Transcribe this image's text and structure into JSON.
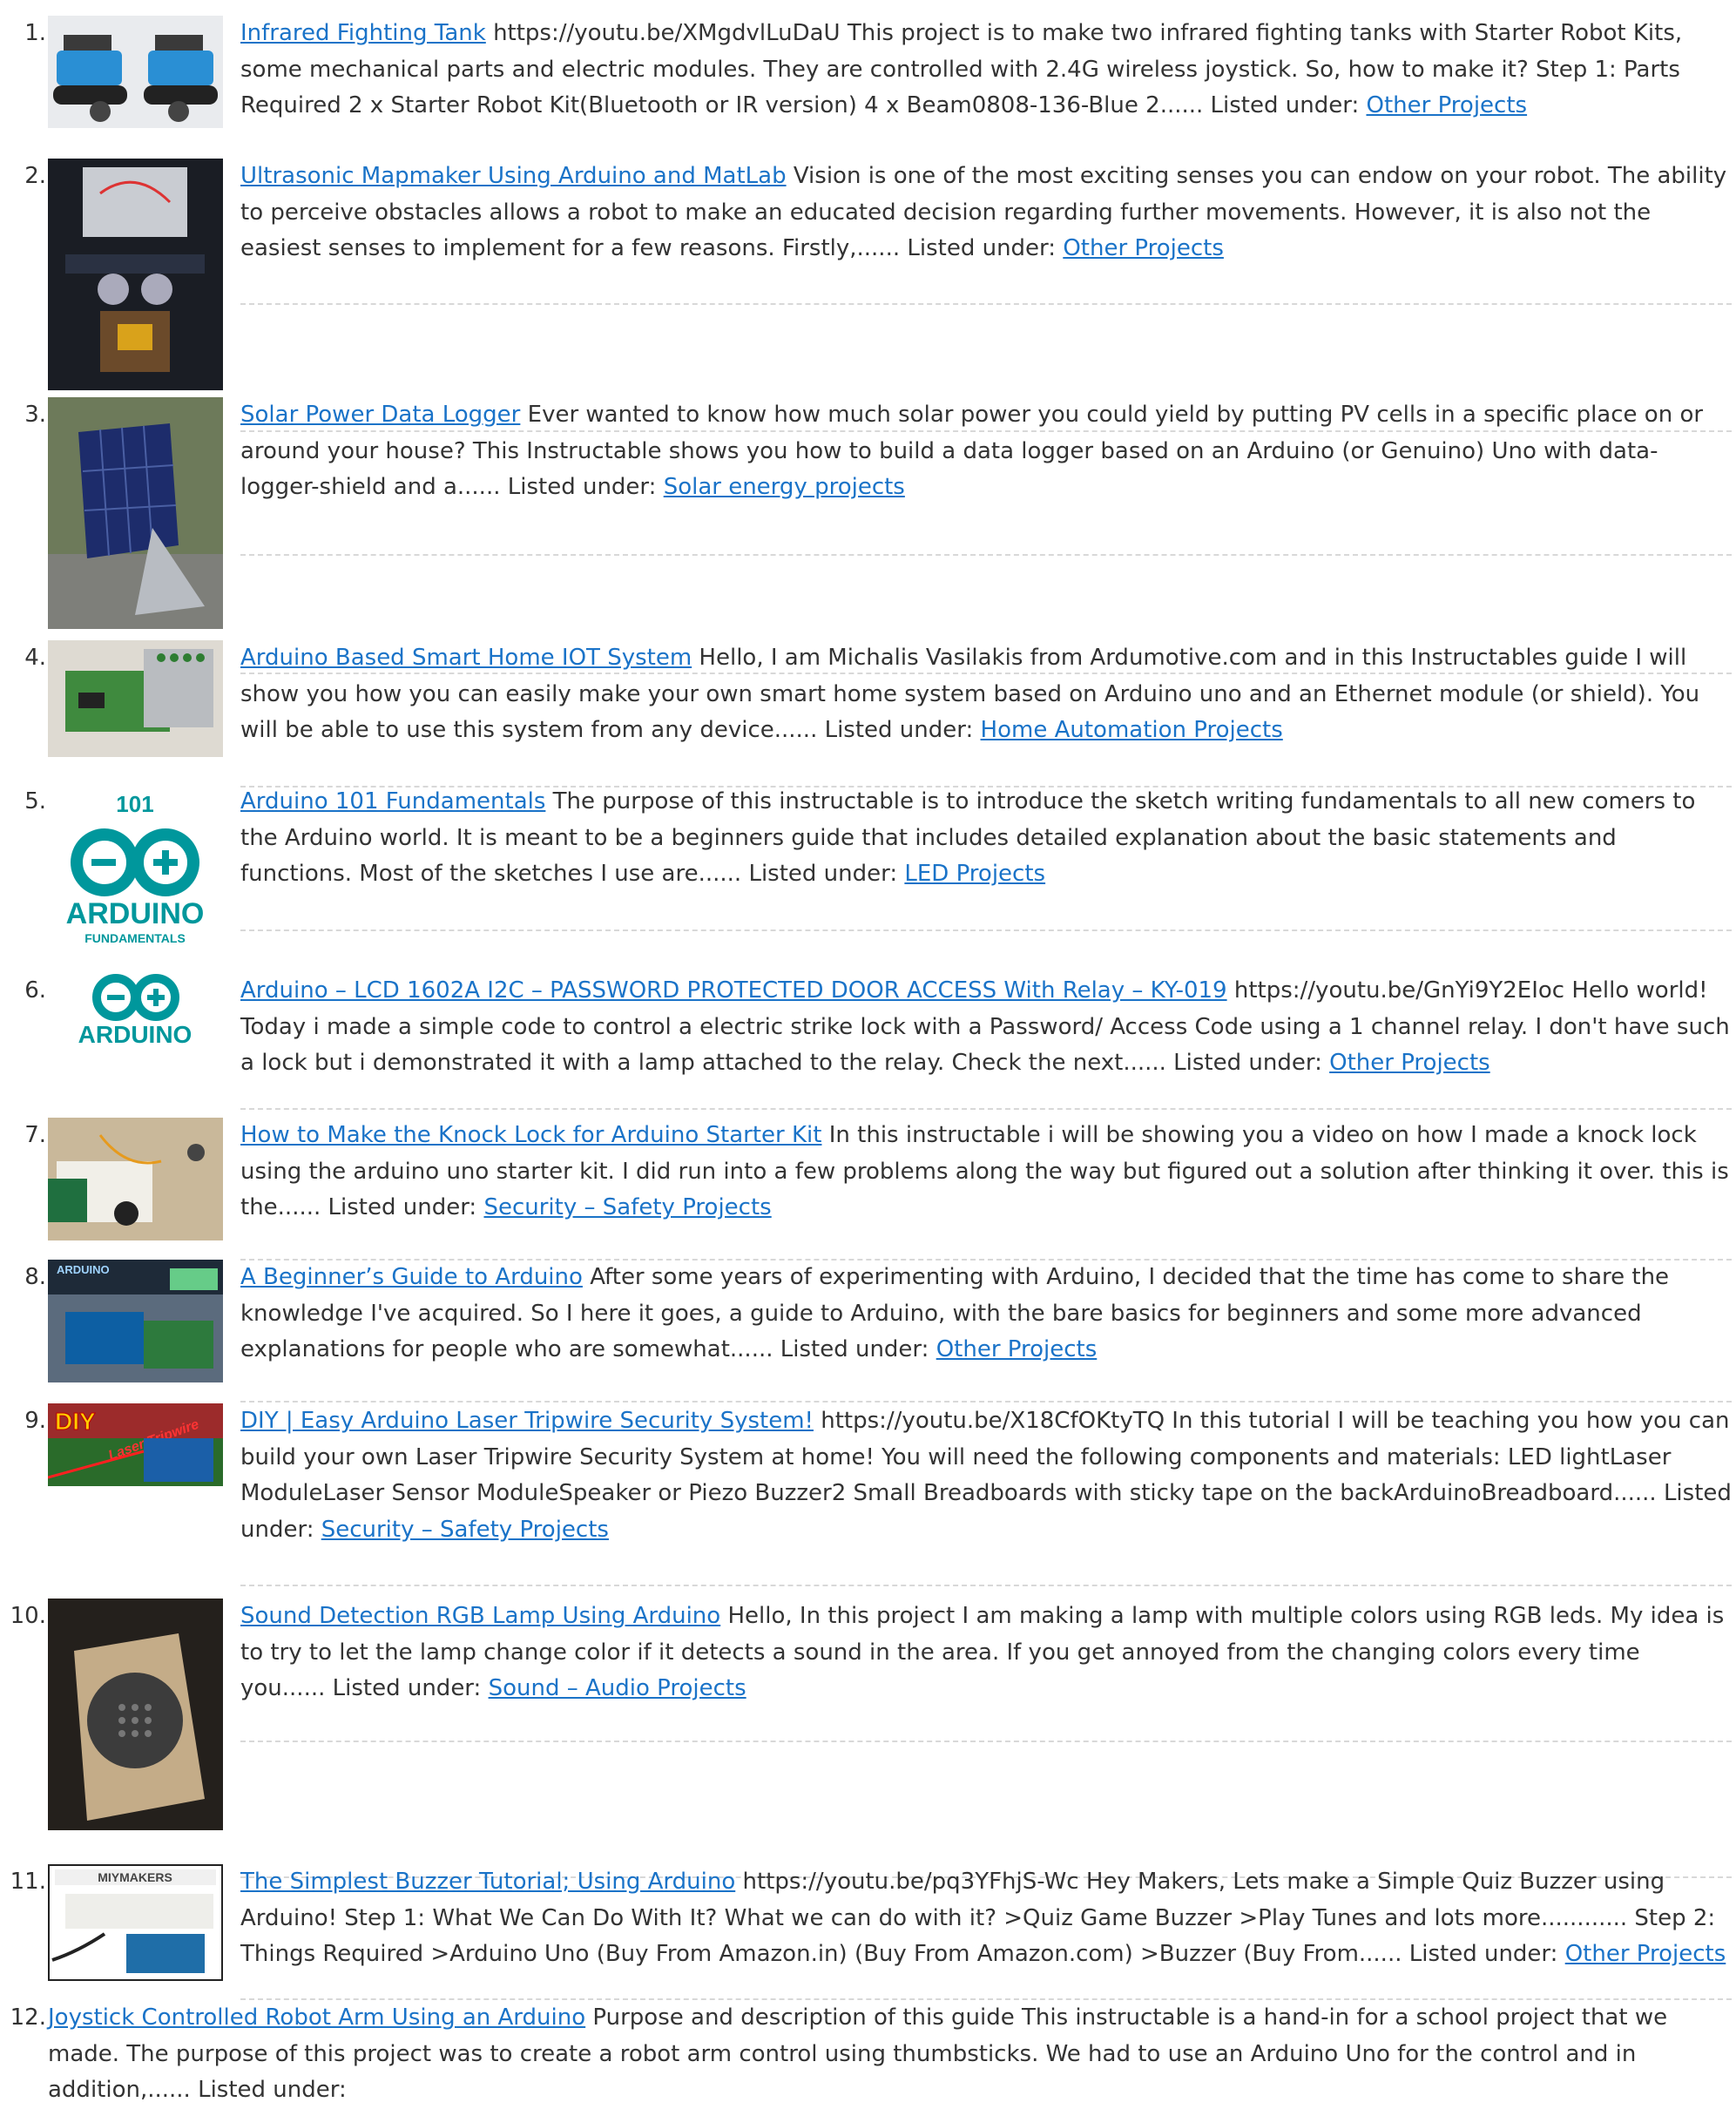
{
  "items": [
    {
      "num": "1.",
      "title": "Infrared Fighting Tank",
      "body": "https://youtu.be/XMgdvlLuDaU This project is to make two infrared fighting tanks with Starter Robot Kits, some mechanical parts and electric modules. They are controlled with 2.4G wireless joystick. So, how to make it? Step 1: Parts Required 2 x Starter Robot Kit(Bluetooth or IR version) 4 x Beam0808-136-Blue 2......",
      "listed_label": "Listed under:",
      "category": "Other Projects",
      "thumb_icon": "robot-tanks-photo"
    },
    {
      "num": "2.",
      "title": "Ultrasonic Mapmaker Using Arduino and MatLab",
      "body": "Vision is one of the most exciting senses you can endow on your robot. The ability to perceive obstacles allows a robot to make an educated decision regarding further movements. However, it is also not the easiest senses to implement for a few reasons. Firstly,......",
      "listed_label": "Listed under:",
      "category": "Other Projects",
      "thumb_icon": "ultrasonic-robot-photo"
    },
    {
      "num": "3.",
      "title": "Solar Power Data Logger",
      "body": "Ever wanted to know how much solar power you could yield by putting PV cells in a specific place on or around your house? This Instructable shows you how to build a data logger based on an Arduino (or Genuino) Uno with data-logger-shield and a......",
      "listed_label": "Listed under:",
      "category": "Solar energy projects",
      "thumb_icon": "solar-panel-photo"
    },
    {
      "num": "4.",
      "title": "Arduino Based Smart Home IOT System",
      "body": "Hello, I am Michalis Vasilakis from Ardumotive.com and in this Instructables guide I will show you how you can easily make your own smart home system based on Arduino uno and an Ethernet module (or shield). You will be able to use this system from any device......",
      "listed_label": "Listed under:",
      "category": "Home Automation Projects",
      "thumb_icon": "smart-home-board-photo"
    },
    {
      "num": "5.",
      "title": "Arduino 101 Fundamentals",
      "body": "The purpose of this instructable is to introduce the sketch writing fundamentals to all new comers to the Arduino world. It is meant to be a beginners guide that includes detailed explanation about the basic statements and functions. Most of the sketches I use are......",
      "listed_label": "Listed under:",
      "category": "LED Projects",
      "thumb_icon": "arduino-logo",
      "thumb_text": {
        "top": "101",
        "brand": "ARDUINO",
        "sub": "FUNDAMENTALS"
      }
    },
    {
      "num": "6.",
      "title": "Arduino – LCD 1602A I2C – PASSWORD PROTECTED DOOR ACCESS With Relay – KY-019",
      "body": "https://youtu.be/GnYi9Y2EIoc Hello world! Today i made a simple code to control a electric strike lock with a Password/ Access Code using a 1 channel relay. I don't have such a lock but i demonstrated it with a lamp attached to the relay. Check the next......",
      "listed_label": "Listed under:",
      "category": "Other Projects",
      "thumb_icon": "arduino-logo",
      "thumb_text": {
        "brand": "ARDUINO"
      }
    },
    {
      "num": "7.",
      "title": "How to Make the Knock Lock for Arduino Starter Kit",
      "body": "In this instructable i will be showing you a video on how I made a knock lock using the arduino uno starter kit. I did run into a few problems along the way but figured out a solution after thinking it over. this is the......",
      "listed_label": "Listed under:",
      "category": "Security – Safety Projects",
      "thumb_icon": "breadboard-photo"
    },
    {
      "num": "8.",
      "title": "A Beginner’s Guide to Arduino",
      "body": "After some years of experimenting with Arduino, I decided that the time has come to share the knowledge I've acquired. So I here it goes, a guide to Arduino, with the bare basics for beginners and some more advanced explanations for people who are somewhat......",
      "listed_label": "Listed under:",
      "category": "Other Projects",
      "thumb_icon": "arduino-workbench-photo",
      "thumb_text": {
        "top": "ARDUINO"
      }
    },
    {
      "num": "9.",
      "title": "DIY | Easy Arduino Laser Tripwire Security System!",
      "body": "https://youtu.be/X18CfOKtyTQ In this tutorial I will be teaching you how you can build your own Laser Tripwire Security System at home! You will need the following components and materials: LED lightLaser ModuleLaser Sensor ModuleSpeaker or Piezo Buzzer2 Small Breadboards with sticky tape on the backArduinoBreadboard......",
      "listed_label": "Listed under:",
      "category": "Security – Safety Projects",
      "thumb_icon": "laser-tripwire-photo",
      "thumb_text": {
        "top": "DIY",
        "sub": "Laser Tripwire"
      }
    },
    {
      "num": "10.",
      "title": "Sound Detection RGB Lamp Using Arduino",
      "body": "Hello, In this project I am making a lamp with multiple colors using RGB leds. My idea is to try to let the lamp change color if it detects a sound in the area. If you get annoyed from the changing colors every time you......",
      "listed_label": "Listed under:",
      "category": "Sound – Audio Projects",
      "thumb_icon": "rgb-lamp-photo"
    },
    {
      "num": "11.",
      "title": "The Simplest Buzzer Tutorial; Using Arduino",
      "body": "https://youtu.be/pq3YFhjS-Wc Hey Makers, Lets make a Simple Quiz Buzzer using Arduino! Step 1: What We Can Do With It? What we can do with it? >Quiz Game Buzzer >Play Tunes and lots more............ Step 2: Things Required >Arduino Uno (Buy From Amazon.in) (Buy From Amazon.com) >Buzzer (Buy From......",
      "listed_label": "Listed under:",
      "category": "Other Projects",
      "thumb_icon": "buzzer-breadboard-photo",
      "thumb_text": {
        "top": "MIYMAKERS"
      }
    },
    {
      "num": "12.",
      "title": "Joystick Controlled Robot Arm Using an Arduino",
      "body": "Purpose and description of this guide This instructable is a hand-in for a school project that we made. The purpose of this project was to create a robot arm control using thumbsticks. We had to use an Arduino Uno for the control and in addition,......",
      "listed_label": "Listed under:",
      "category": "",
      "thumb_icon": ""
    }
  ],
  "colors": {
    "link": "#1a73c8",
    "text": "#333333",
    "separator": "#d8d8d8",
    "arduino_teal": "#00979c"
  }
}
